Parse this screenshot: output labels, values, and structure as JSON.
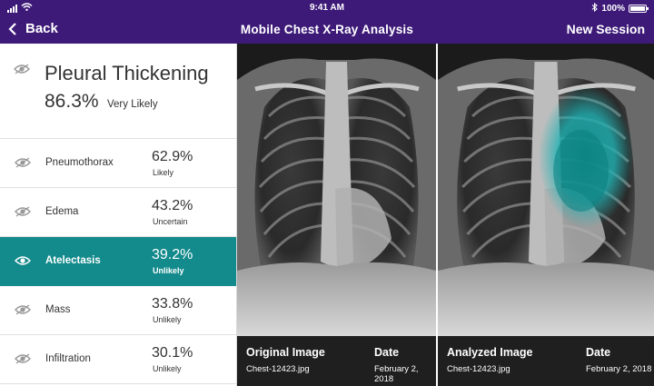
{
  "status_bar": {
    "wifi_icon": "wifi-icon",
    "time": "9:41 AM",
    "bluetooth_icon": "bluetooth-icon",
    "battery_text": "100%",
    "battery_level": 1.0
  },
  "nav": {
    "back_label": "Back",
    "title": "Mobile Chest X-Ray Analysis",
    "new_session_label": "New Session"
  },
  "colors": {
    "nav_background": "#3d1a78",
    "active_row": "#138a8b",
    "heatmap": "#1fb1b3"
  },
  "top_finding": {
    "name": "Pleural Thickening",
    "percent": "86.3%",
    "likelihood": "Very Likely",
    "icon": "eye-icon"
  },
  "findings": [
    {
      "name": "Pneumothorax",
      "percent": "62.9%",
      "likelihood": "Likely",
      "active": false
    },
    {
      "name": "Edema",
      "percent": "43.2%",
      "likelihood": "Uncertain",
      "active": false
    },
    {
      "name": "Atelectasis",
      "percent": "39.2%",
      "likelihood": "Unlikely",
      "active": true
    },
    {
      "name": "Mass",
      "percent": "33.8%",
      "likelihood": "Unlikely",
      "active": false
    },
    {
      "name": "Infiltration",
      "percent": "30.1%",
      "likelihood": "Unlikely",
      "active": false
    }
  ],
  "original": {
    "label": "Original Image",
    "filename": "Chest-12423.jpg",
    "date_label": "Date",
    "date": "February 2, 2018"
  },
  "analyzed": {
    "label": "Analyzed Image",
    "filename": "Chest-12423.jpg",
    "date_label": "Date",
    "date": "February 2, 2018"
  }
}
